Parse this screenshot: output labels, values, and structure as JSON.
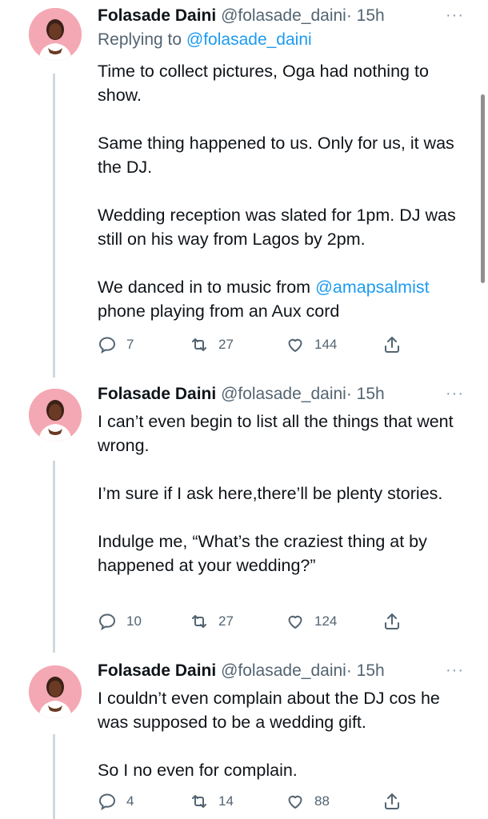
{
  "colors": {
    "link": "#1d9bf0",
    "secondary_text": "#536471",
    "thread_line": "#cfd9de",
    "avatar_bg": "#f4a8b3"
  },
  "tweets": [
    {
      "author_name": "Folasade Daini",
      "handle": "@folasade_daini",
      "separator": "·",
      "time": "15h",
      "more": "···",
      "replying_prefix": "Replying to",
      "replying_to": "@folasade_daini",
      "paragraphs": [
        "Time to collect pictures, Oga had nothing to show.",
        "Same thing happened to us. Only for us, it was the DJ.",
        "Wedding reception was slated for 1pm. DJ was still on his way from Lagos by 2pm."
      ],
      "last_mention": "@amapsalmist",
      "last_lead": "We danced in to music from",
      "last_tail": "phone playing from an Aux cord",
      "replies": "7",
      "retweets": "27",
      "likes": "144"
    },
    {
      "author_name": "Folasade Daini",
      "handle": "@folasade_daini",
      "separator": "·",
      "time": "15h",
      "more": "···",
      "paragraphs": [
        "I can’t even begin to list all the things that went wrong.",
        "I’m sure if I ask here,there’ll be plenty stories.",
        "Indulge me, “What’s the craziest thing at by happened at your wedding?”"
      ],
      "replies": "10",
      "retweets": "27",
      "likes": "124"
    },
    {
      "author_name": "Folasade Daini",
      "handle": "@folasade_daini",
      "separator": "·",
      "time": "15h",
      "more": "···",
      "paragraphs": [
        "I couldn’t even complain about the DJ cos he was supposed to be a wedding gift.",
        "So I no even for complain."
      ],
      "replies": "4",
      "retweets": "14",
      "likes": "88"
    }
  ],
  "icons": {
    "reply": "comment-icon",
    "retweet": "retweet-icon",
    "like": "heart-icon",
    "share": "share-icon",
    "more": "more-options-icon"
  }
}
